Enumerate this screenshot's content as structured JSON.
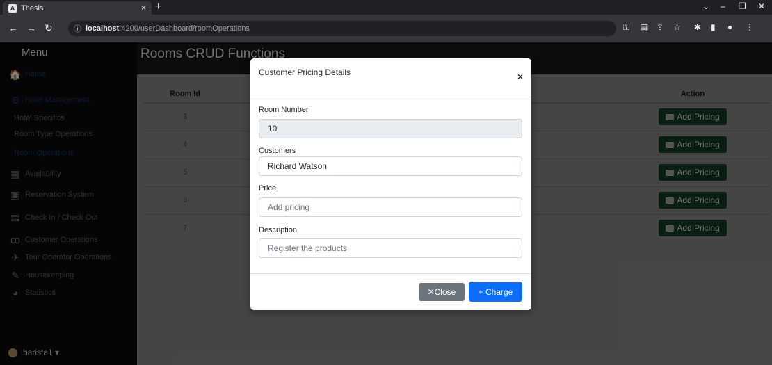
{
  "browser": {
    "tab_title": "Thesis",
    "tab_favicon": "A",
    "tab_close": "×",
    "new_tab": "+",
    "url_host": "localhost",
    "url_path": ":4200/userDashboard/roomOperations",
    "win_min": "–",
    "win_max": "❐",
    "win_close": "✕",
    "win_dropdown": "⌄"
  },
  "sidebar": {
    "title": "Menu",
    "items": [
      {
        "label": "Home",
        "icon": "🏠"
      },
      {
        "label": "Hotel Management",
        "icon": "⚙"
      },
      {
        "label": "Hotel Specifics"
      },
      {
        "label": "Room Type Operations"
      },
      {
        "label": "Room Operations"
      },
      {
        "label": "Availability",
        "icon": "▦"
      },
      {
        "label": "Reservation System",
        "icon": "▣"
      },
      {
        "label": "Check In / Check Out",
        "icon": "▤"
      },
      {
        "label": "Customer Operations",
        "icon": "ꝏ"
      },
      {
        "label": "Tour Operator Operations",
        "icon": "✈"
      },
      {
        "label": "Housekeeping",
        "icon": "✎"
      },
      {
        "label": "Statistics",
        "icon": "◕"
      }
    ],
    "user": "barista1 ▾"
  },
  "main": {
    "title": "Rooms CRUD Functions",
    "columns": [
      "Room Id",
      "",
      "Action"
    ],
    "rows": [
      {
        "id": "3",
        "action": "Add Pricing"
      },
      {
        "id": "4",
        "action": "Add Pricing"
      },
      {
        "id": "5",
        "action": "Add Pricing"
      },
      {
        "id": "6",
        "action": "Add Pricing"
      },
      {
        "id": "7",
        "action": "Add Pricing"
      }
    ]
  },
  "modal": {
    "title": "Customer Pricing Details",
    "close_x": "×",
    "room_number_label": "Room Number",
    "room_number_value": "10",
    "customers_label": "Customers",
    "customers_value": "Richard Watson",
    "price_label": "Price",
    "price_placeholder": "Add pricing",
    "description_label": "Description",
    "description_placeholder": "Register the products",
    "close_button": "✕Close",
    "charge_button": "+ Charge"
  },
  "colors": {
    "primary": "#0d6efd",
    "secondary": "#6c757d",
    "success_dimmed": "#0f3a22"
  }
}
